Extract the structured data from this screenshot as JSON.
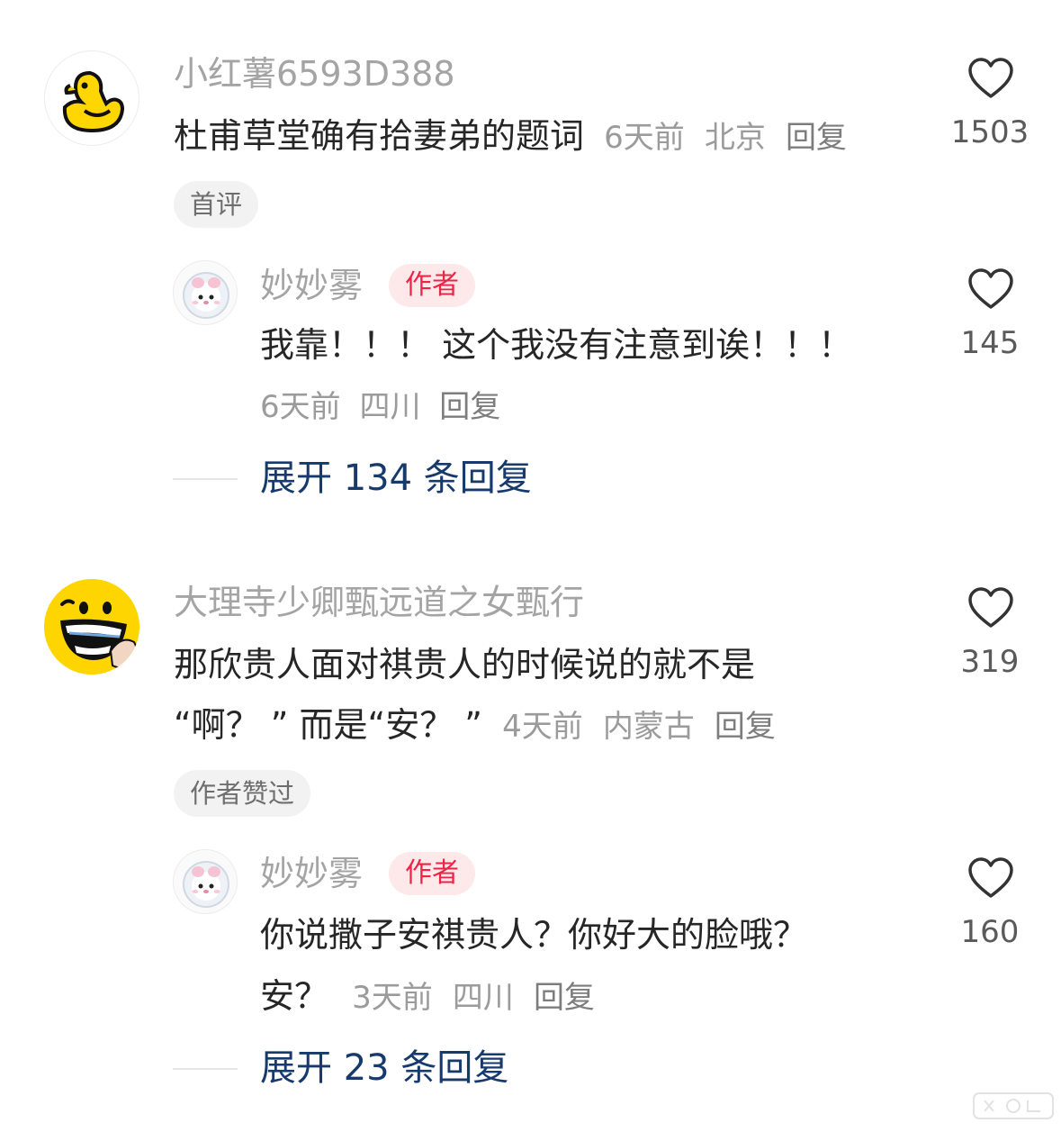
{
  "comments": [
    {
      "username": "小红薯6593D388",
      "text": "杜甫草堂确有拾妻弟的题词",
      "time": "6天前",
      "location": "北京",
      "reply_label": "回复",
      "likes": "1503",
      "tag": "首评",
      "avatar_icon": "duck-icon",
      "reply": {
        "username": "妙妙雾",
        "badge": "作者",
        "text_line1": "我靠！！！ 这个我没有注意到诶！！！",
        "time": "6天前",
        "location": "四川",
        "reply_label": "回复",
        "likes": "145",
        "avatar_icon": "bear-astronaut-icon"
      },
      "expand_label": "展开 134 条回复"
    },
    {
      "username": "大理寺少卿甄远道之女甄行",
      "text_line1": "那欣贵人面对祺贵人的时候说的就不是",
      "text_line2": "“啊？ ” 而是“安？ ”",
      "time": "4天前",
      "location": "内蒙古",
      "reply_label": "回复",
      "likes": "319",
      "tag": "作者赞过",
      "avatar_icon": "grin-face-icon",
      "reply": {
        "username": "妙妙雾",
        "badge": "作者",
        "text_line1": "你说撒子安祺贵人？你好大的脸哦？",
        "text_line2": "安？",
        "time": "3天前",
        "location": "四川",
        "reply_label": "回复",
        "likes": "160",
        "avatar_icon": "bear-astronaut-icon"
      },
      "expand_label": "展开 23 条回复"
    }
  ],
  "colors": {
    "username": "#a4a4a4",
    "text": "#262626",
    "meta": "#9b9b9b",
    "author_badge_bg": "#fde8ea",
    "author_badge_fg": "#ee2348",
    "expand_link": "#163a6b",
    "tag_bg": "#f2f2f2"
  }
}
